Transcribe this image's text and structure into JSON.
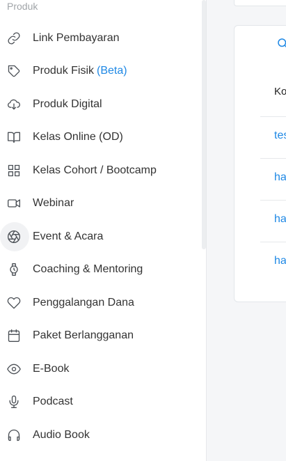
{
  "sidebar": {
    "section_label": "Produk",
    "items": [
      {
        "label": "Link Pembayaran",
        "icon": "link-icon"
      },
      {
        "label": "Produk Fisik",
        "badge": "(Beta)",
        "icon": "tag-icon"
      },
      {
        "label": "Produk Digital",
        "icon": "cloud-download-icon"
      },
      {
        "label": "Kelas Online (OD)",
        "icon": "book-icon"
      },
      {
        "label": "Kelas Cohort / Bootcamp",
        "icon": "grid-icon"
      },
      {
        "label": "Webinar",
        "icon": "video-icon"
      },
      {
        "label": "Event & Acara",
        "icon": "aperture-icon",
        "active": true
      },
      {
        "label": "Coaching & Mentoring",
        "icon": "watch-icon"
      },
      {
        "label": "Penggalangan Dana",
        "icon": "heart-icon"
      },
      {
        "label": "Paket Berlangganan",
        "icon": "calendar-icon"
      },
      {
        "label": "E-Book",
        "icon": "eye-icon"
      },
      {
        "label": "Podcast",
        "icon": "microphone-icon"
      },
      {
        "label": "Audio Book",
        "icon": "headphones-icon"
      }
    ]
  },
  "main": {
    "table": {
      "header": "Ko",
      "rows": [
        "tes",
        "ha",
        "ha",
        "ha"
      ]
    }
  },
  "colors": {
    "accent": "#1e88e5",
    "text": "#333333",
    "muted": "#a0a4a8"
  }
}
